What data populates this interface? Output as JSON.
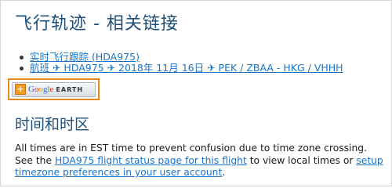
{
  "page_title": "飞行轨迹 - 相关链接",
  "links": [
    {
      "text": "实时飞行跟踪 (HDA975)"
    },
    {
      "text": "航班 ✈ HDA975 ✈ 2018年 11月 16日 ✈ PEK / ZBAA - HKG / VHHH"
    }
  ],
  "google_earth": {
    "plus": "+",
    "brand": [
      "G",
      "o",
      "o",
      "g",
      "l",
      "e"
    ],
    "earth": "EARTH"
  },
  "section_title": "时间和时区",
  "paragraph": {
    "part1": "All times are in EST time to prevent confusion due to time zone crossing. See the ",
    "link1": "HDA975 flight status page for this flight",
    "part2": " to view local times or ",
    "link2": "setup timezone preferences in your user account",
    "part3": "."
  }
}
